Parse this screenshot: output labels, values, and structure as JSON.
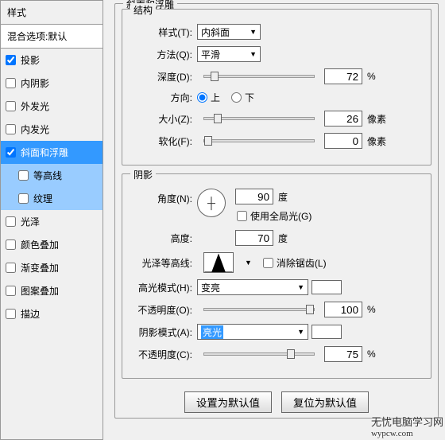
{
  "left": {
    "title": "样式",
    "subtitle": "混合选项:默认",
    "items": [
      {
        "label": "投影",
        "checked": true,
        "selected": false
      },
      {
        "label": "内阴影",
        "checked": false,
        "selected": false
      },
      {
        "label": "外发光",
        "checked": false,
        "selected": false
      },
      {
        "label": "内发光",
        "checked": false,
        "selected": false
      },
      {
        "label": "斜面和浮雕",
        "checked": true,
        "selected": true
      },
      {
        "label": "等高线",
        "checked": false,
        "sub": true
      },
      {
        "label": "纹理",
        "checked": false,
        "sub": true
      },
      {
        "label": "光泽",
        "checked": false,
        "selected": false
      },
      {
        "label": "颜色叠加",
        "checked": false,
        "selected": false
      },
      {
        "label": "渐变叠加",
        "checked": false,
        "selected": false
      },
      {
        "label": "图案叠加",
        "checked": false,
        "selected": false
      },
      {
        "label": "描边",
        "checked": false,
        "selected": false
      }
    ]
  },
  "right": {
    "main_title": "斜面和浮雕",
    "structure": {
      "title": "结构",
      "style_label": "样式(T):",
      "style_value": "内斜面",
      "method_label": "方法(Q):",
      "method_value": "平滑",
      "depth_label": "深度(D):",
      "depth_value": "72",
      "depth_unit": "%",
      "direction_label": "方向:",
      "up": "上",
      "down": "下",
      "size_label": "大小(Z):",
      "size_value": "26",
      "size_unit": "像素",
      "soften_label": "软化(F):",
      "soften_value": "0",
      "soften_unit": "像素"
    },
    "shading": {
      "title": "阴影",
      "angle_label": "角度(N):",
      "angle_value": "90",
      "angle_unit": "度",
      "global_light": "使用全局光(G)",
      "altitude_label": "高度:",
      "altitude_value": "70",
      "altitude_unit": "度",
      "gloss_label": "光泽等高线:",
      "antialias": "消除锯齿(L)",
      "highlight_mode_label": "高光模式(H):",
      "highlight_mode_value": "变亮",
      "highlight_opacity_label": "不透明度(O):",
      "highlight_opacity_value": "100",
      "highlight_opacity_unit": "%",
      "shadow_mode_label": "阴影模式(A):",
      "shadow_mode_value": "亮光",
      "shadow_opacity_label": "不透明度(C):",
      "shadow_opacity_value": "75",
      "shadow_opacity_unit": "%"
    },
    "buttons": {
      "default": "设置为默认值",
      "reset": "复位为默认值"
    }
  },
  "watermark": {
    "line1": "无忧电脑学习网",
    "line2": "wypcw.com"
  }
}
